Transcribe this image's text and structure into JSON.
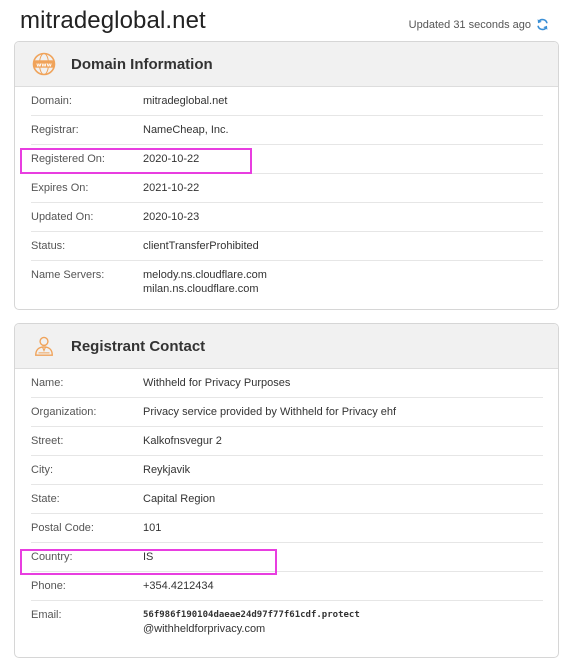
{
  "page": {
    "domain_title": "mitradeglobal.net",
    "updated_text": "Updated 31 seconds ago"
  },
  "domain_info": {
    "title": "Domain Information",
    "icon": "www-globe-icon",
    "rows": [
      {
        "label": "Domain:",
        "value": "mitradeglobal.net"
      },
      {
        "label": "Registrar:",
        "value": "NameCheap, Inc."
      },
      {
        "label": "Registered On:",
        "value": "2020-10-22"
      },
      {
        "label": "Expires On:",
        "value": "2021-10-22"
      },
      {
        "label": "Updated On:",
        "value": "2020-10-23"
      },
      {
        "label": "Status:",
        "value": "clientTransferProhibited"
      },
      {
        "label": "Name Servers:",
        "values": [
          "melody.ns.cloudflare.com",
          "milan.ns.cloudflare.com"
        ]
      }
    ]
  },
  "registrant": {
    "title": "Registrant Contact",
    "icon": "person-icon",
    "rows": [
      {
        "label": "Name:",
        "value": "Withheld for Privacy Purposes"
      },
      {
        "label": "Organization:",
        "value": "Privacy service provided by Withheld for Privacy ehf"
      },
      {
        "label": "Street:",
        "value": "Kalkofnsvegur 2"
      },
      {
        "label": "City:",
        "value": "Reykjavik"
      },
      {
        "label": "State:",
        "value": "Capital Region"
      },
      {
        "label": "Postal Code:",
        "value": "101"
      },
      {
        "label": "Country:",
        "value": "IS"
      },
      {
        "label": "Phone:",
        "value": "+354.4212434"
      },
      {
        "label": "Email:",
        "values": [
          "56f986f190104daeae24d97f77f61cdf.protect",
          "@withheldforprivacy.com"
        ]
      }
    ]
  },
  "colors": {
    "accent_orange": "#f0a35a",
    "refresh_blue": "#3a8fd6",
    "highlight_magenta": "#e83ee0"
  }
}
